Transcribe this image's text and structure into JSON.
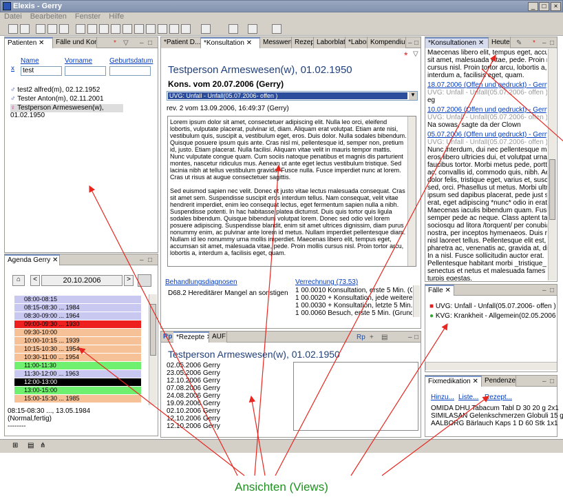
{
  "window": {
    "title": "Elexis - Gerry"
  },
  "menu": [
    "Datei",
    "Bearbeiten",
    "Fenster",
    "Hilfe"
  ],
  "patients": {
    "tabs": [
      "Patienten",
      "Fälle und Kons"
    ],
    "columns": [
      "Name",
      "Vorname",
      "Geburtsdatum"
    ],
    "search_value": "test",
    "x_label": "x",
    "rows": [
      "test2 alfred(m), 02.12.1952",
      "Tester Anton(m), 02.11.2001",
      "Testperson Armeswesen(w), 01.02.1950"
    ]
  },
  "agenda": {
    "tab": "Agenda Gerry",
    "date": "20.10.2006",
    "items": [
      {
        "text": "08:00-08:15",
        "color": "#c8c8f0"
      },
      {
        "text": "08:15-08:30 ... 1984",
        "color": "#c8c8f0"
      },
      {
        "text": "08:30-09:00 ... 1964",
        "color": "#c8c8f0"
      },
      {
        "text": "09:00-09:30 ... 1930",
        "color": "#ee1f1f"
      },
      {
        "text": "09:30-10:00",
        "color": "#f6c197"
      },
      {
        "text": "10:00-10:15 ... 1939",
        "color": "#f6c197"
      },
      {
        "text": "10:15-10:30 ... 1954",
        "color": "#f6c197"
      },
      {
        "text": "10:30-11:00 ... 1954",
        "color": "#f6c197"
      },
      {
        "text": "11:00-11:30",
        "color": "#6ff06f"
      },
      {
        "text": "11:30-12:00 ... 1963",
        "color": "#c8c8f0"
      },
      {
        "text": "12:00-13:00",
        "color": "#000000"
      },
      {
        "text": "13:00-15:00",
        "color": "#6ff06f"
      },
      {
        "text": "15:00-15:30 ... 1985",
        "color": "#f6c197"
      }
    ],
    "detail": [
      "08:15-08:30 ..., 13.05.1984",
      "(Normal,fertig)",
      "--------"
    ]
  },
  "consult": {
    "tabs": [
      "*Patient D...",
      "*Konsultation",
      "Messwerte",
      "Rezept",
      "Laborblatt",
      "*Labor",
      "Kompendiu..."
    ],
    "patient": "Testperson Armeswesen(w), 01.02.1950",
    "kons": "Kons. vom 20.07.2006 (Gerry)",
    "case": "UVG: Unfall - Unfall(05.07.2006- offen )",
    "rev": "rev. 2 vom 13.09.2006, 16:49:37 (Gerry)",
    "p1": "Lorem ipsum dolor sit amet, consectetuer adipiscing elit. Nulla leo orci, eleifend lobortis, vulputate placerat, pulvinar id, diam. Aliquam erat volutpat. Etiam ante nisi, vestibulum quis, suscipit a, vestibulum eget, eros. Duis dolor. Nulla sodales bibendum. Quisque posuere ipsum quis ante. Cras nisl mi, pellentesque id, semper non, pretium id, justo. Etiam placerat. Nulla facilisi. Aliquam vitae velit in mauris tempor mattis. Nunc vulputate congue quam. Cum sociis natoque penatibus et magnis dis parturient montes, nascetur ridiculus mus. Aenean ut ante eget lectus vestibulum tristique. Sed lacinia nibh at tellus vestibulum gravida. Fusce nulla. Fusce imperdiet nunc at lorem. Cras ut risus at augue consectetuer sagittis.",
    "p2": "Sed euismod sapien nec velit. Donec et justo vitae lectus malesuada consequat. Cras sit amet sem. Suspendisse suscipit eros interdum tellus. Nam consequat, velit vitae hendrerit imperdiet, enim leo consequat lectus, eget fermentum sapien nulla a nibh. Suspendisse potenti. In hac habitasse platea dictumst. Duis quis tortor quis ligula sodales bibendum. Quisque bibendum volutpat lorem. Donec sed odio vel lorem posuere adipiscing. Suspendisse blandit, enim sit amet ultrices dignissim, diam purus nonummy enim, ac pulvinar ante lorem id metus. Nullam imperdiet pellentesque diam. Nullam id leo nonummy urna mollis imperdiet. Maecenas libero elit, tempus eget, accumsan sit amet, malesuada vitae, pede. Proin mollis cursus nisl. Proin tortor arcu, lobortis a, interdum a, facilisis eget, quam.",
    "diag_label": "Behandlungsdiagnosen",
    "diag_value": "D68.2 Hereditärer Mangel an sonstigen Gerinnun",
    "bill_label": "Verrechnung (73.53)",
    "bill_lines": [
      "1 00.0010 Konsultation, erste 5 Min. (Grundko",
      "1 00.0020 + Konsultation, jede weiteren 5 Mi",
      "1 00.0030 + Konsultation, letzte 5 Min. (Kons",
      "1 00.0060 Besuch, erste 5 Min. (Grundbesuch"
    ]
  },
  "rezepte": {
    "tabs": [
      "*Rezepte",
      "AUF"
    ],
    "patient": "Testperson Armeswesen(w), 01.02.1950",
    "list": [
      "02.05.2006 Gerry",
      "23.05.2006 Gerry",
      "12.10.2006 Gerry",
      "07.08.2006 Gerry",
      "24.08.2006 Gerry",
      "19.09.2006 Gerry",
      "02.10.2006 Gerry",
      "12.10.2006 Gerry",
      "12.10.2006 Gerry"
    ]
  },
  "history": {
    "tabs": [
      "*Konsultationen",
      "Heute"
    ],
    "lines": [
      {
        "t": "Maecenas libero elit, tempus eget, accumsan",
        "s": "n"
      },
      {
        "t": "sit amet, malesuada vitae, pede. Proin mollis",
        "s": "n"
      },
      {
        "t": "cursus nisl. Proin tortor arcu, lobortis a,",
        "s": "n"
      },
      {
        "t": "interdum a, facilisis eget, quam.",
        "s": "n"
      },
      {
        "t": "18.07.2006 (Offen und gedruckt) - Gerry",
        "s": "l"
      },
      {
        "t": "UVG: Unfall - Unfall(05.07.2006- offen )",
        "s": "g"
      },
      {
        "t": "eg",
        "s": "n"
      },
      {
        "t": "10.07.2006 (Offen und gedruckt) - Gerry",
        "s": "l"
      },
      {
        "t": "UVG: Unfall - Unfall(05.07.2006- offen )",
        "s": "g"
      },
      {
        "t": "Na sowas, sagte da der Clown",
        "s": "n"
      },
      {
        "t": "05.07.2006 (Offen und gedruckt) - Gerry",
        "s": "l"
      },
      {
        "t": "UVG: Unfall - Unfall(05.07.2006- offen )",
        "s": "g"
      },
      {
        "t": "Nunc interdum, dui nec pellentesque mattis,",
        "s": "n"
      },
      {
        "t": "eros libero ultricies dui, et volutpat urna elit",
        "s": "n"
      },
      {
        "t": "faucibus tortor. Morbi metus pede, porttitor",
        "s": "n"
      },
      {
        "t": "ac, convallis id, commodo quis, nibh. Aenean",
        "s": "n"
      },
      {
        "t": "dolor felis, tristique eget, varius et, suscipit",
        "s": "n"
      },
      {
        "t": "sed, orci. Phasellus ut metus. Morbi ultrices,",
        "s": "n"
      },
      {
        "t": "ipsum sed dapibus placerat, pede just semper",
        "s": "n"
      },
      {
        "t": "erat, eget adipiscing *nunc* odio in erat.",
        "s": "n"
      },
      {
        "t": "Maecenas iaculis bibendum quam. Fusce",
        "s": "n"
      },
      {
        "t": "semper pede ac neque. Class aptent taciti",
        "s": "n"
      },
      {
        "t": "sociosqu ad litora /torquent/ per conubia",
        "s": "n"
      },
      {
        "t": "nostra, per inceptos hymenaeos. Duis rutrum",
        "s": "n"
      },
      {
        "t": "nisl laoreet tellus. Pellentesque elit est,",
        "s": "n"
      },
      {
        "t": "pharetra ac, venenatis ac, gravida at, diam.",
        "s": "n"
      },
      {
        "t": "In a nisl. Fusce sollicitudin auctor erat.",
        "s": "n"
      },
      {
        "t": "Pellentesque habitant morbi _tristique_",
        "s": "n"
      },
      {
        "t": "senectus et netus et malesuada fames ac",
        "s": "n"
      },
      {
        "t": "turpis egestas.",
        "s": "n"
      },
      {
        "t": "29.06.2006 (Storniert) - Gerry",
        "s": "l"
      },
      {
        "t": "UVG: Krankheit - Allgemein(02.05.2006- offen",
        "s": "g"
      }
    ]
  },
  "faelle": {
    "tab": "Fälle",
    "items": [
      "UVG: Unfall - Unfall(05.07.2006- offen )",
      "KVG: Krankheit - Allgemein(02.05.2006- offen"
    ]
  },
  "fix": {
    "tabs": [
      "Fixmedikation",
      "Pendenzen"
    ],
    "links": [
      "Hinzu...",
      "Liste...",
      "Rezept..."
    ],
    "items": [
      "OMIDA DHU Tabacum Tabl D 30 20 g 2x1",
      "SIMILASAN Gelenkschmerzen Globuli 15 g 3x8",
      "AALBORG Bärlauch Kaps 1 D 60 Stk 1x1"
    ]
  },
  "caption": "Ansichten (Views)",
  "colors": {
    "accent": "#22407a",
    "link": "#003cbf",
    "caption": "#1f9020",
    "arrow": "#e8261f"
  }
}
